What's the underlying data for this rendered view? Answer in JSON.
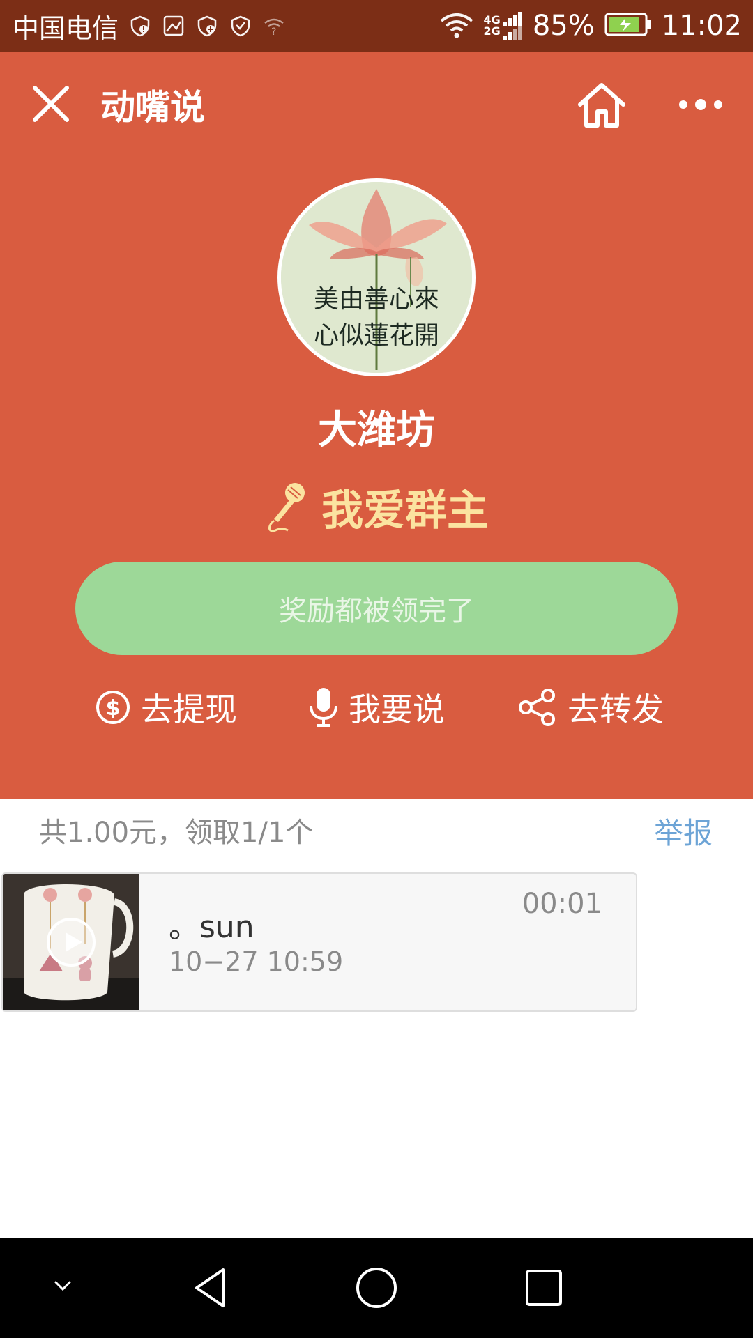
{
  "status_bar": {
    "carrier": "中国电信",
    "network_top": "4G",
    "network_bottom": "2G",
    "battery_percent": "85%",
    "time": "11:02"
  },
  "header": {
    "title": "动嘴说"
  },
  "profile": {
    "name": "大潍坊",
    "avatar_text_line1": "美由善心來",
    "avatar_text_line2": "心似蓮花開"
  },
  "topic": {
    "text": "我爱群主"
  },
  "reward_button": {
    "label": "奖励都被领完了"
  },
  "actions": {
    "withdraw": "去提现",
    "speak": "我要说",
    "share": "去转发"
  },
  "summary": {
    "text": "共1.00元，领取1/1个",
    "report": "举报"
  },
  "voice_item": {
    "name": "。sun",
    "time": "10−27 10:59",
    "duration": "00:01"
  },
  "colors": {
    "hero_bg": "#d95c40",
    "status_bg": "#7c2e16",
    "reward_button_bg": "#9dd898",
    "topic_color": "#fbe3a0",
    "link_color": "#6da4d6"
  }
}
